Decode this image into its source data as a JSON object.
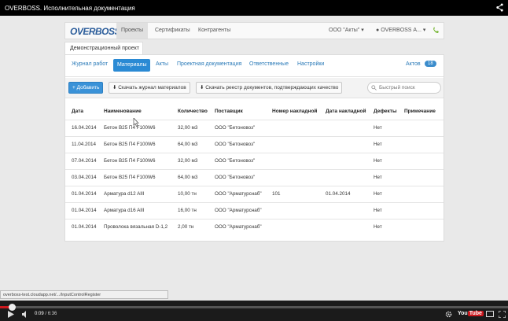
{
  "video": {
    "title": "OVERBOSS. Исполнительная документация",
    "time_current": "0:09",
    "time_total": "/ 6:36",
    "progress": 0.023,
    "status_url": "overboss-test.cloudapp.net/.../InputControlRegister"
  },
  "app": {
    "logo": "OVERBOSS",
    "nav": [
      {
        "label": "Проекты",
        "active": true
      },
      {
        "label": "Сертификаты",
        "active": false
      },
      {
        "label": "Контрагенты",
        "active": false
      }
    ],
    "company": "ООО \"Акты\" ▾",
    "user": "OVERBOSS А... ▾"
  },
  "project": {
    "tab_label": "Демонстрационный проект"
  },
  "subnav": {
    "tabs": [
      {
        "label": "Журнал работ",
        "active": false
      },
      {
        "label": "Материалы",
        "active": true
      },
      {
        "label": "Акты",
        "active": false
      },
      {
        "label": "Проектная документация",
        "active": false
      },
      {
        "label": "Ответственные",
        "active": false
      },
      {
        "label": "Настройки",
        "active": false
      }
    ],
    "acts_label": "Актов",
    "acts_count": "18"
  },
  "toolbar": {
    "add_label": "+ Добавить",
    "download_journal_label": "Скачать журнал материалов",
    "download_registry_label": "Скачать реестр документов, подтверждающих качество",
    "search_placeholder": "Быстрый поиск"
  },
  "table": {
    "headers": [
      "Дата",
      "Наименование",
      "Количество",
      "Поставщик",
      "Номер накладной",
      "Дата накладной",
      "Дефекты",
      "Примечание"
    ],
    "rows": [
      [
        "16.04.2014",
        "Бетон В25 П4 F100W6",
        "32,00 м3",
        "ООО \"Бетоновоз\"",
        "",
        "",
        "Нет",
        ""
      ],
      [
        "11.04.2014",
        "Бетон В25 П4 F100W6",
        "64,00 м3",
        "ООО \"Бетоновоз\"",
        "",
        "",
        "Нет",
        ""
      ],
      [
        "07.04.2014",
        "Бетон В25 П4 F100W6",
        "32,00 м3",
        "ООО \"Бетоновоз\"",
        "",
        "",
        "Нет",
        ""
      ],
      [
        "03.04.2014",
        "Бетон В25 П4 F100W6",
        "64,00 м3",
        "ООО \"Бетоновоз\"",
        "",
        "",
        "Нет",
        ""
      ],
      [
        "01.04.2014",
        "Арматура d12 AIII",
        "10,00 тн",
        "ООО \"Арматурснаб\"",
        "101",
        "01.04.2014",
        "Нет",
        ""
      ],
      [
        "01.04.2014",
        "Арматура d16 AIII",
        "16,00 тн",
        "ООО \"Арматурснаб\"",
        "",
        "",
        "Нет",
        ""
      ],
      [
        "01.04.2014",
        "Проволока вязальная D-1,2",
        "2,00 тн",
        "ООО \"Арматурснаб\"",
        "",
        "",
        "Нет",
        ""
      ]
    ]
  },
  "colors": {
    "accent": "#2a8ad4",
    "progress": "#cc181e"
  }
}
